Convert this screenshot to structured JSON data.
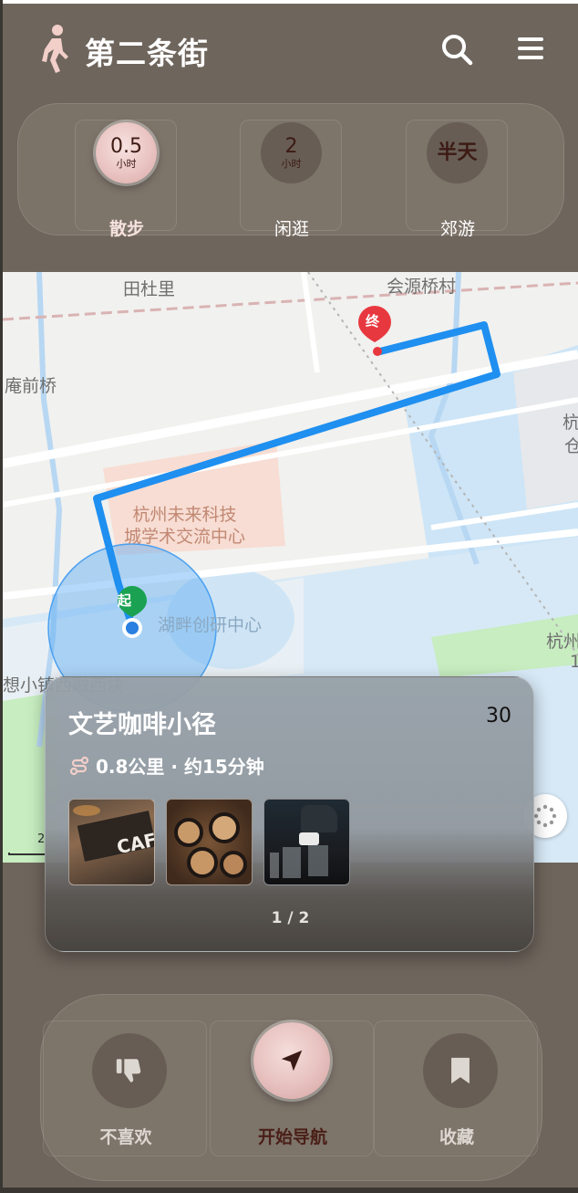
{
  "app": {
    "title": "第二条街"
  },
  "header": {
    "brand_icon": "walking-person-icon",
    "search_icon": "search-icon",
    "menu_icon": "hamburger-menu-icon"
  },
  "modes": [
    {
      "value": "0.5",
      "unit": "小时",
      "label": "散步",
      "active": true
    },
    {
      "value": "2",
      "unit": "小时",
      "label": "闲逛",
      "active": false
    },
    {
      "value": "半天",
      "unit": "",
      "label": "郊游",
      "active": false
    }
  ],
  "map": {
    "labels": {
      "village1": "田杜里",
      "village2": "会源桥村",
      "bridge": "庵前桥",
      "poi1_line1": "杭州未来科技",
      "poi1_line2": "城学术交流中心",
      "poi2": "湖畔创研中心",
      "edge1": "杭",
      "edge1b": "仓",
      "edge2": "杭州",
      "edge2b": "1",
      "partial": "想小镇西融西块",
      "scale": "2"
    },
    "start_marker": "起",
    "end_marker": "终",
    "colors": {
      "route": "#1f8ff0",
      "start": "#1aa252",
      "end": "#e8383f",
      "water": "#cde5f6",
      "green": "#c7edc0"
    }
  },
  "route_card": {
    "title": "文艺咖啡小径",
    "count": "30",
    "meta": "0.8公里 · 约15分钟",
    "meta_icon": "route-icon",
    "thumbnails": [
      "cafe-interior-photo",
      "latte-art-photo",
      "coffee-brewing-photo"
    ],
    "cafe_sign": "CAF",
    "pager": "1 / 2"
  },
  "actions": [
    {
      "label": "不喜欢",
      "icon": "thumbs-down-icon",
      "active": false
    },
    {
      "label": "开始导航",
      "icon": "navigation-arrow-icon",
      "active": true
    },
    {
      "label": "收藏",
      "icon": "bookmark-icon",
      "active": false
    }
  ]
}
